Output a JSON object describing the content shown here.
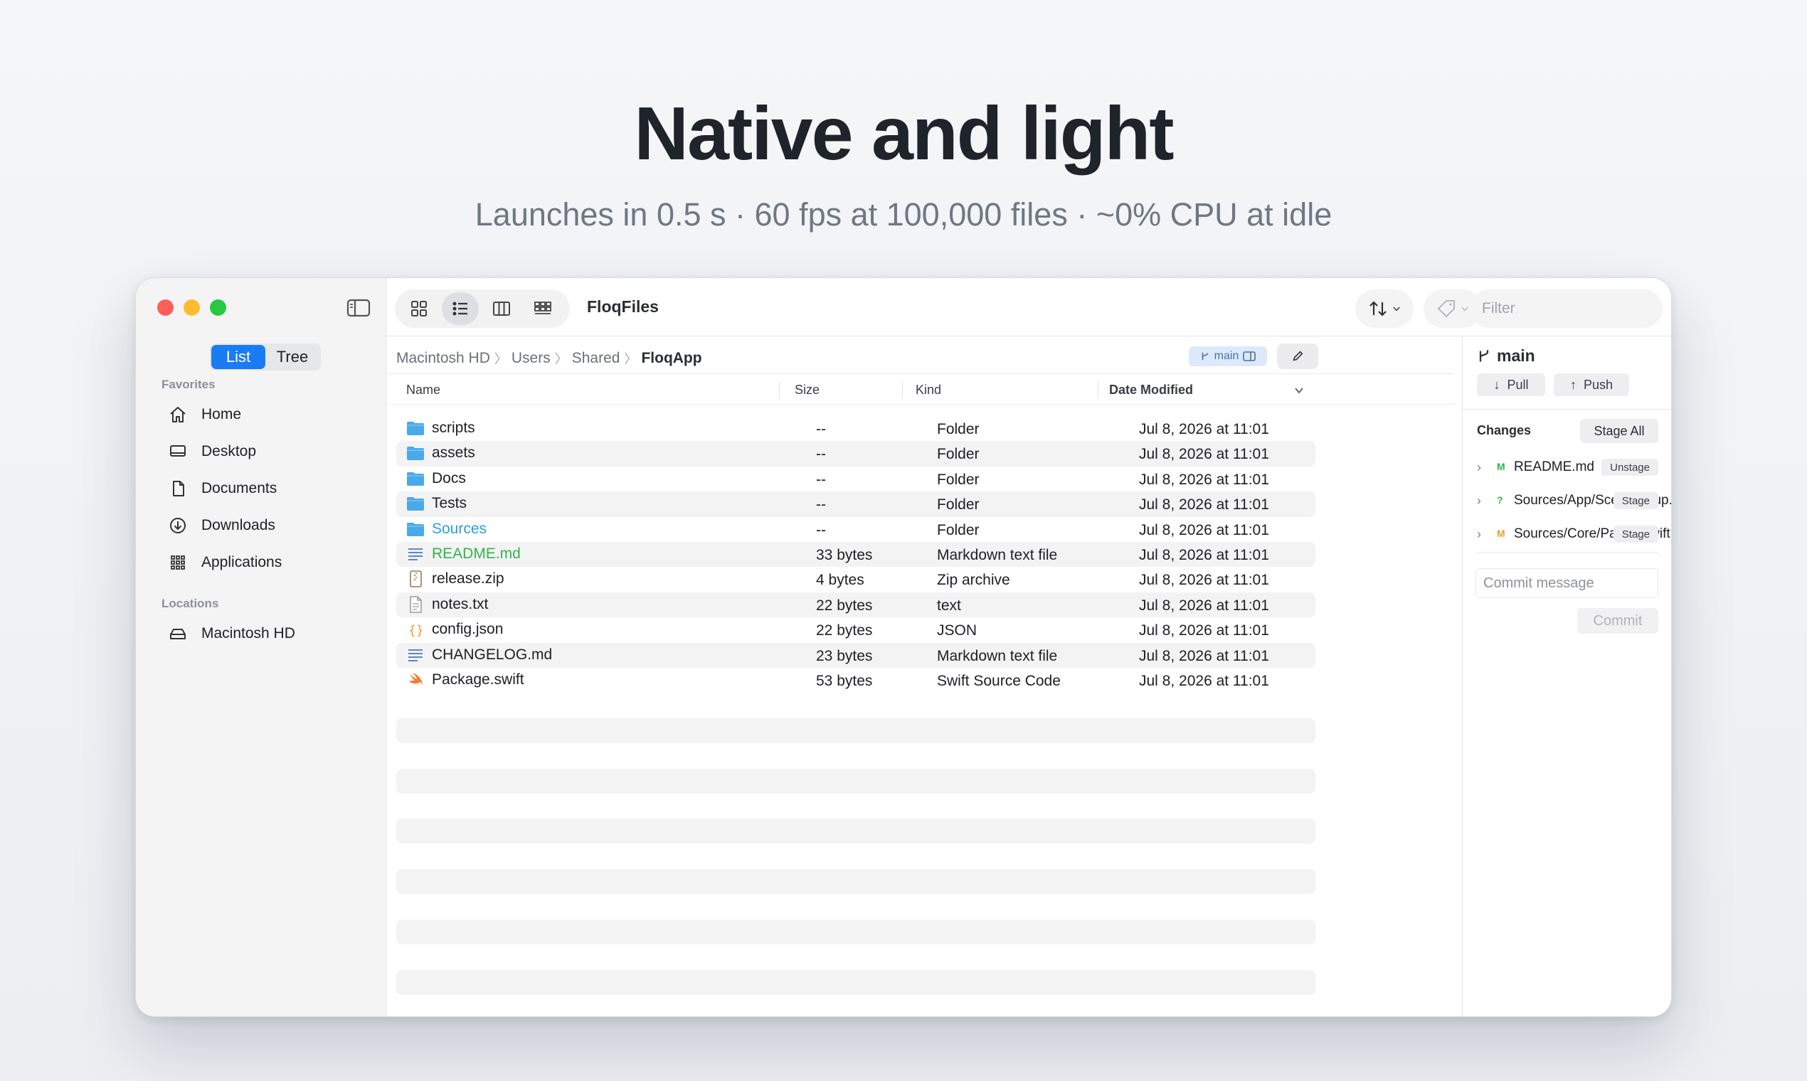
{
  "hero": {
    "title": "Native and light",
    "subtitle": "Launches in 0.5 s · 60 fps at 100,000 files · ~0% CPU at idle"
  },
  "toolbar": {
    "app_title": "FloqFiles",
    "filter_placeholder": "Filter",
    "view_modes": [
      "icon-grid",
      "list",
      "columns",
      "gallery"
    ],
    "active_view": "list"
  },
  "sidebar": {
    "segment": {
      "list_label": "List",
      "tree_label": "Tree",
      "active": "List"
    },
    "favorites_label": "Favorites",
    "favorites": [
      {
        "label": "Home",
        "icon": "house-icon"
      },
      {
        "label": "Desktop",
        "icon": "display-icon"
      },
      {
        "label": "Documents",
        "icon": "document-icon"
      },
      {
        "label": "Downloads",
        "icon": "download-icon"
      },
      {
        "label": "Applications",
        "icon": "apps-grid-icon"
      }
    ],
    "locations_label": "Locations",
    "locations": [
      {
        "label": "Macintosh HD",
        "icon": "drive-icon"
      }
    ]
  },
  "breadcrumb": {
    "parts": [
      "Macintosh HD",
      "Users",
      "Shared"
    ],
    "current": "FloqApp",
    "branch_chip": "main"
  },
  "columns": {
    "name": "Name",
    "size": "Size",
    "kind": "Kind",
    "date": "Date Modified"
  },
  "files": [
    {
      "name": "scripts",
      "size": "--",
      "kind": "Folder",
      "date": "Jul 8, 2026 at 11:01",
      "icon": "folder-icon",
      "color": ""
    },
    {
      "name": "assets",
      "size": "--",
      "kind": "Folder",
      "date": "Jul 8, 2026 at 11:01",
      "icon": "folder-icon",
      "color": ""
    },
    {
      "name": "Docs",
      "size": "--",
      "kind": "Folder",
      "date": "Jul 8, 2026 at 11:01",
      "icon": "folder-icon",
      "color": ""
    },
    {
      "name": "Tests",
      "size": "--",
      "kind": "Folder",
      "date": "Jul 8, 2026 at 11:01",
      "icon": "folder-icon",
      "color": ""
    },
    {
      "name": "Sources",
      "size": "--",
      "kind": "Folder",
      "date": "Jul 8, 2026 at 11:01",
      "icon": "folder-icon",
      "color": "#2aa0d8"
    },
    {
      "name": "README.md",
      "size": "33 bytes",
      "kind": "Markdown text file",
      "date": "Jul 8, 2026 at 11:01",
      "icon": "markdown-file-icon",
      "color": "#34b34a"
    },
    {
      "name": "release.zip",
      "size": "4 bytes",
      "kind": "Zip archive",
      "date": "Jul 8, 2026 at 11:01",
      "icon": "zip-file-icon",
      "color": ""
    },
    {
      "name": "notes.txt",
      "size": "22 bytes",
      "kind": "text",
      "date": "Jul 8, 2026 at 11:01",
      "icon": "text-file-icon",
      "color": ""
    },
    {
      "name": "config.json",
      "size": "22 bytes",
      "kind": "JSON",
      "date": "Jul 8, 2026 at 11:01",
      "icon": "json-file-icon",
      "color": ""
    },
    {
      "name": "CHANGELOG.md",
      "size": "23 bytes",
      "kind": "Markdown text file",
      "date": "Jul 8, 2026 at 11:01",
      "icon": "markdown-file-icon",
      "color": ""
    },
    {
      "name": "Package.swift",
      "size": "53 bytes",
      "kind": "Swift Source Code",
      "date": "Jul 8, 2026 at 11:01",
      "icon": "swift-file-icon",
      "color": ""
    }
  ],
  "git": {
    "branch": "main",
    "pull_label": "Pull",
    "push_label": "Push",
    "changes_label": "Changes",
    "stage_all_label": "Stage All",
    "changes": [
      {
        "status": "M",
        "status_color": "#34b34a",
        "path": "README.md",
        "action": "Unstage"
      },
      {
        "status": "?",
        "status_color": "#34b34a",
        "path": "Sources/App/SceneSetup.swift",
        "action": "Stage"
      },
      {
        "status": "M",
        "status_color": "#f0a030",
        "path": "Sources/Core/Parser.swift",
        "action": "Stage"
      }
    ],
    "commit_placeholder": "Commit message",
    "commit_label": "Commit"
  },
  "colors": {
    "accent": "#1a7cf5",
    "folder": "#4aa9e9"
  }
}
